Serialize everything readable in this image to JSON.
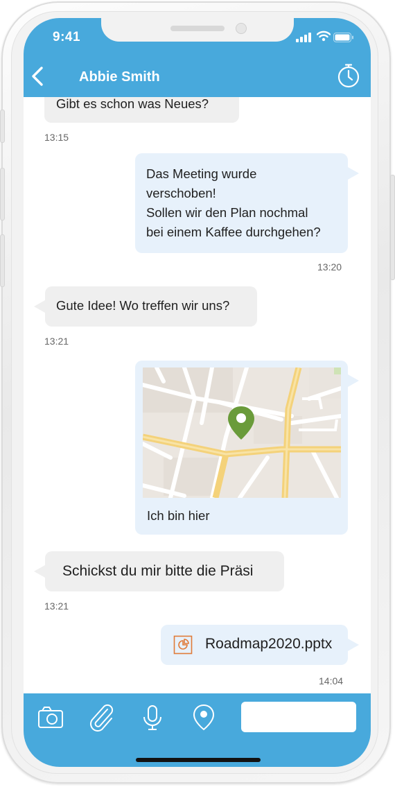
{
  "status": {
    "time": "9:41"
  },
  "header": {
    "contact_name": "Abbie Smith",
    "back_icon": "chevron-left-icon",
    "timer_icon": "stopwatch-icon"
  },
  "messages": [
    {
      "direction": "in",
      "text": "Gibt es schon was Neues?",
      "time": "13:15"
    },
    {
      "direction": "out",
      "text": "Das Meeting wurde\nverschoben!\nSollen wir den Plan nochmal\nbei einem Kaffee durchgehen?",
      "time": "13:20"
    },
    {
      "direction": "in",
      "text": "Gute Idee! Wo treffen wir uns?",
      "time": "13:21"
    },
    {
      "direction": "out",
      "type": "location",
      "text": "Ich bin hier",
      "pin_color": "#6a9b3a"
    },
    {
      "direction": "in",
      "text": "Schickst du mir bitte die Präsi",
      "time": "13:21"
    },
    {
      "direction": "out",
      "type": "file",
      "file_name": "Roadmap2020.pptx",
      "file_icon": "presentation-file-icon",
      "time": "14:04"
    }
  ],
  "toolbar": {
    "icons": [
      "camera-icon",
      "paperclip-icon",
      "microphone-icon",
      "location-pin-icon"
    ],
    "input_placeholder": ""
  },
  "colors": {
    "accent": "#48a9dc",
    "incoming_bubble": "#efefef",
    "outgoing_bubble": "#e7f1fb",
    "file_icon": "#e07b39"
  }
}
